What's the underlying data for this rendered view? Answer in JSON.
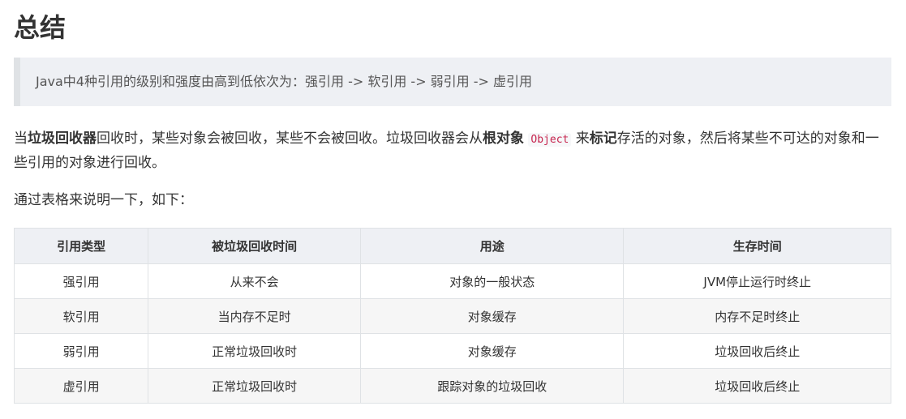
{
  "heading": "总结",
  "quote": "Java中4种引用的级别和强度由高到低依次为：强引用 -> 软引用 -> 弱引用 -> 虚引用",
  "paragraph1": {
    "t1": "当",
    "b1": "垃圾回收器",
    "t2": "回收时，某些对象会被回收，某些不会被回收。垃圾回收器会从",
    "b2": "根对象",
    "code": "Object",
    "t3": "来",
    "b3": "标记",
    "t4": "存活的对象，然后将某些不可达的对象和一些引用的对象进行回收。"
  },
  "paragraph2": "通过表格来说明一下，如下：",
  "table": {
    "headers": [
      "引用类型",
      "被垃圾回收时间",
      "用途",
      "生存时间"
    ],
    "rows": [
      [
        "强引用",
        "从来不会",
        "对象的一般状态",
        "JVM停止运行时终止"
      ],
      [
        "软引用",
        "当内存不足时",
        "对象缓存",
        "内存不足时终止"
      ],
      [
        "弱引用",
        "正常垃圾回收时",
        "对象缓存",
        "垃圾回收后终止"
      ],
      [
        "虚引用",
        "正常垃圾回收时",
        "跟踪对象的垃圾回收",
        "垃圾回收后终止"
      ]
    ]
  }
}
